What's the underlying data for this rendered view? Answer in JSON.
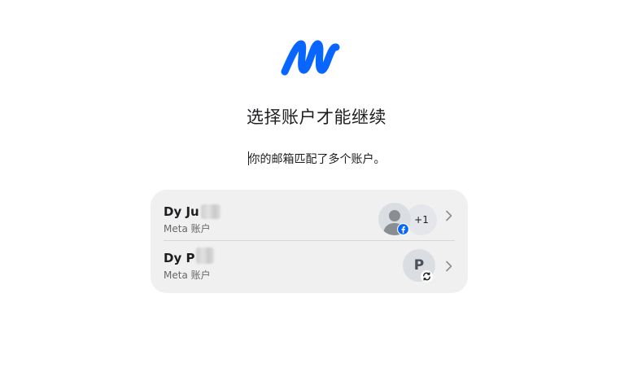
{
  "brand": {
    "accent": "#0866ff",
    "logo_icon": "meta-m-logo"
  },
  "header": {
    "title": "选择账户才能继续",
    "subtitle": "你的邮箱匹配了多个账户。"
  },
  "accounts": [
    {
      "name_visible": "Dy Ju",
      "account_type": "Meta 账户",
      "avatar_icon": "person-avatar-icon",
      "badge_icon": "facebook-badge-icon",
      "extra_count": "+1"
    },
    {
      "name_visible": "Dy P",
      "account_type": "Meta 账户",
      "avatar_letter": "P",
      "badge_icon": "sync-badge-icon"
    }
  ],
  "colors": {
    "card_background": "#f0f0f0",
    "divider": "#d6d6d6",
    "text_primary": "#1c1e21",
    "text_secondary": "#65676b"
  }
}
